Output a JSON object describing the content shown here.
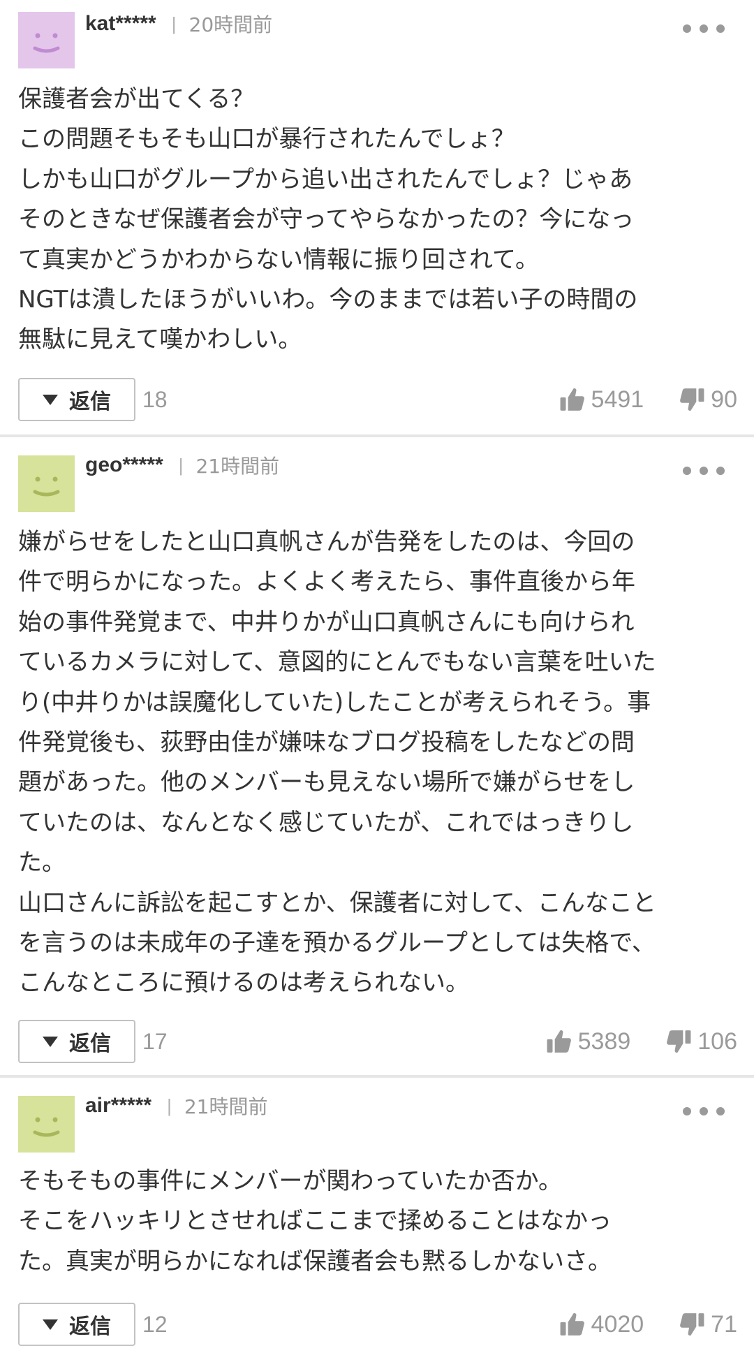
{
  "reply_label": "返信",
  "colors": {
    "avatar_purple_bg": "#e3c6ea",
    "avatar_purple_fg": "#c08bd1",
    "avatar_green_bg": "#d7e39a",
    "avatar_green_fg": "#a9b75c",
    "icon_gray": "#9a9a9a"
  },
  "comments": [
    {
      "user": "kat*****",
      "separator": "|",
      "time": "20時間前",
      "avatar_icon": "smiley-face-icon",
      "body": "保護者会が出てくる？\nこの問題そもそも山口が暴行されたんでしょ？\nしかも山口がグループから追い出されたんでしょ？じゃあ\nそのときなぜ保護者会が守ってやらなかったの？今になっ\nて真実かどうかわからない情報に振り回されて。\nNGTは潰したほうがいいわ。今のままでは若い子の時間の\n無駄に見えて嘆かわしい。",
      "reply_count": "18",
      "likes": "5491",
      "dislikes": "90"
    },
    {
      "user": "geo*****",
      "separator": "|",
      "time": "21時間前",
      "avatar_icon": "smiley-face-icon",
      "body": "嫌がらせをしたと山口真帆さんが告発をしたのは、今回の\n件で明らかになった。よくよく考えたら、事件直後から年\n始の事件発覚まで、中井りかが山口真帆さんにも向けられ\nているカメラに対して、意図的にとんでもない言葉を吐いた\nり(中井りかは誤魔化していた)したことが考えられそう。事\n件発覚後も、荻野由佳が嫌味なブログ投稿をしたなどの問\n題があった。他のメンバーも見えない場所で嫌がらせをし\nていたのは、なんとなく感じていたが、これではっきりし\nた。\n山口さんに訴訟を起こすとか、保護者に対して、こんなこと\nを言うのは未成年の子達を預かるグループとしては失格で、\nこんなところに預けるのは考えられない。",
      "reply_count": "17",
      "likes": "5389",
      "dislikes": "106"
    },
    {
      "user": "air*****",
      "separator": "|",
      "time": "21時間前",
      "avatar_icon": "smiley-face-icon",
      "body": "そもそもの事件にメンバーが関わっていたか否か。\nそこをハッキリとさせればここまで揉めることはなかっ\nた。真実が明らかになれば保護者会も黙るしかないさ。",
      "reply_count": "12",
      "likes": "4020",
      "dislikes": "71"
    }
  ]
}
